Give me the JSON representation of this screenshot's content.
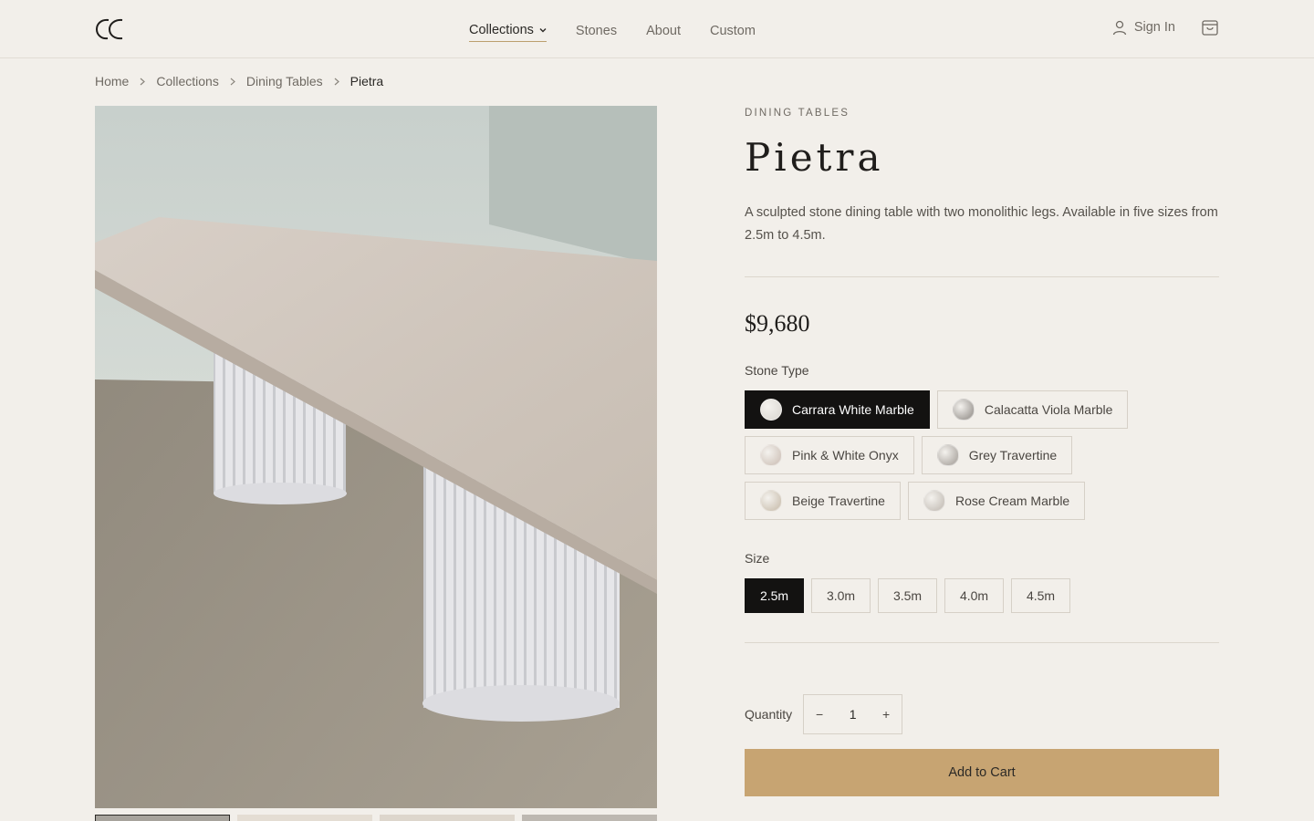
{
  "header": {
    "logo_icon": "cc-monogram-logo",
    "nav": [
      {
        "label": "Collections",
        "active": true
      },
      {
        "label": "Stones"
      },
      {
        "label": "About"
      },
      {
        "label": "Custom"
      }
    ],
    "signin_label": "Sign In",
    "cart_icon": "shopping-bag-icon"
  },
  "breadcrumb": [
    "Home",
    "Collections",
    "Dining Tables",
    "Pietra"
  ],
  "product": {
    "category": "DINING TABLES",
    "title": "Pietra",
    "description": "A sculpted stone dining table with two monolithic legs. Available in five sizes from 2.5m to 4.5m.",
    "price": "$9,680",
    "stone_label": "Stone Type",
    "stones": [
      {
        "label": "Carrara White Marble",
        "selected": true,
        "color": "#d9d6d0"
      },
      {
        "label": "Calacatta Viola Marble",
        "color": "#8a8580"
      },
      {
        "label": "Pink & White Onyx",
        "color": "#c9bbb1"
      },
      {
        "label": "Grey Travertine",
        "color": "#9e9892"
      },
      {
        "label": "Beige Travertine",
        "color": "#c4b8a6"
      },
      {
        "label": "Rose Cream Marble",
        "color": "#bdb6ae"
      }
    ],
    "size_label": "Size",
    "sizes": [
      {
        "label": "2.5m",
        "selected": true
      },
      {
        "label": "3.0m"
      },
      {
        "label": "3.5m"
      },
      {
        "label": "4.0m"
      },
      {
        "label": "4.5m"
      }
    ],
    "quantity_label": "Quantity",
    "quantity": "1",
    "minus": "−",
    "plus": "+",
    "add_to_cart": "Add to Cart"
  },
  "colors": {
    "background": "#f2efea",
    "accent_gold": "#c7a472",
    "selected_dark": "#131211"
  }
}
